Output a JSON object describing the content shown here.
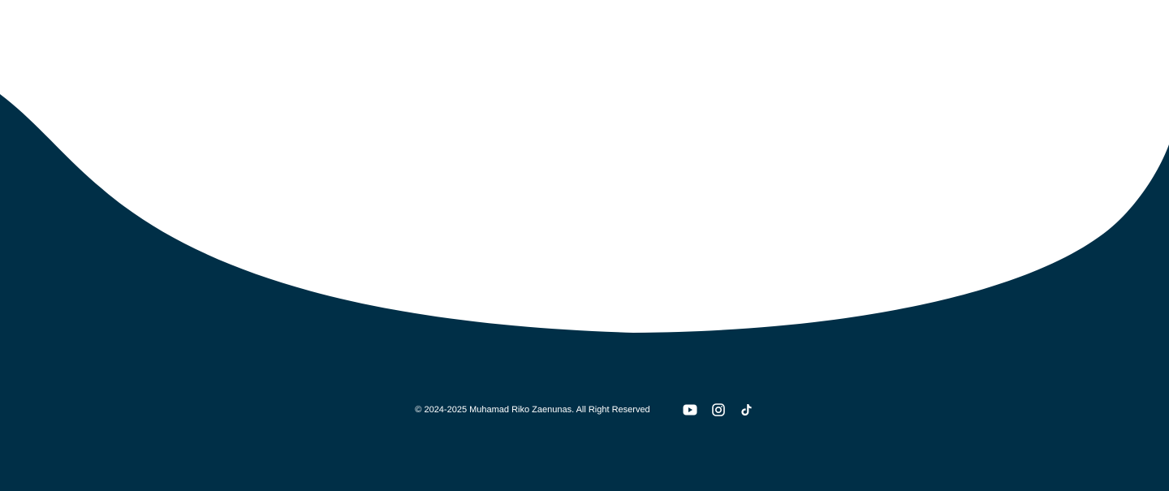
{
  "colors": {
    "footer_background": "#002F47",
    "top_background": "#FFFFFF",
    "text": "#FFFFFF"
  },
  "footer": {
    "copyright": "© 2024-2025 Muhamad Riko Zaenunas. All Right Reserved",
    "social_icons": [
      "youtube-icon",
      "instagram-icon",
      "tiktok-icon"
    ]
  }
}
